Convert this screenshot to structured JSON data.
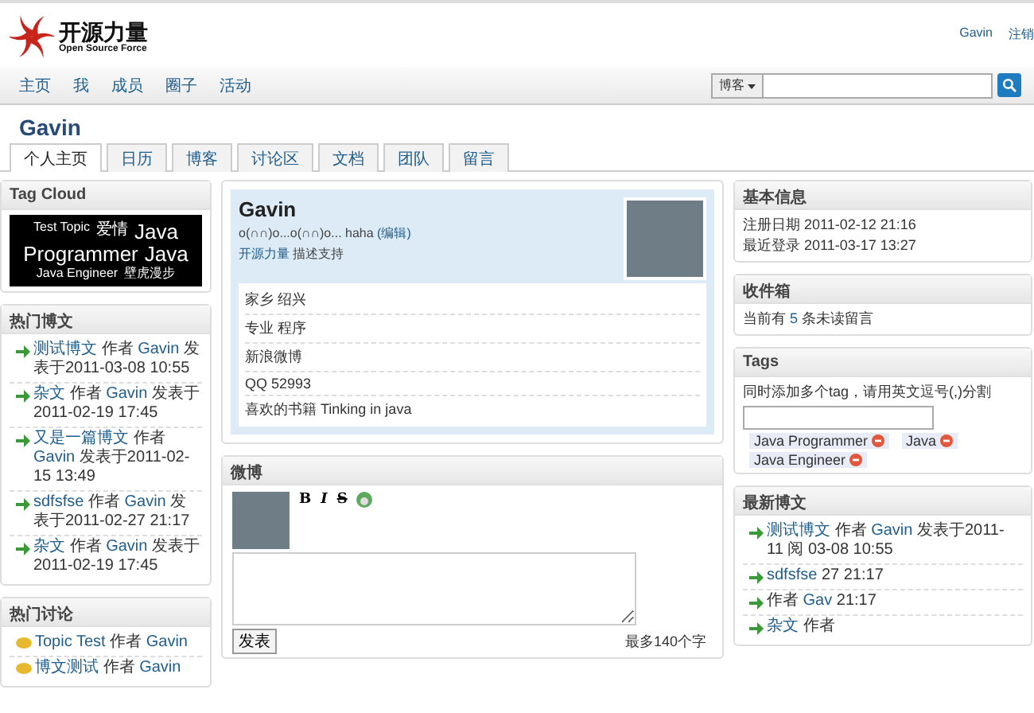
{
  "header": {
    "logo_title": "开源力量",
    "logo_subtitle": "Open Source Force",
    "user_links": [
      "Gavin",
      "注销"
    ]
  },
  "nav": {
    "items": [
      "主页",
      "我",
      "成员",
      "圈子",
      "活动"
    ],
    "search": {
      "scope": "博客"
    }
  },
  "profile_title": "Gavin",
  "tabs": [
    {
      "label": "个人主页",
      "selected": true
    },
    {
      "label": "日历",
      "selected": false
    },
    {
      "label": "博客",
      "selected": false
    },
    {
      "label": "讨论区",
      "selected": false
    },
    {
      "label": "文档",
      "selected": false
    },
    {
      "label": "团队",
      "selected": false
    },
    {
      "label": "留言",
      "selected": false
    }
  ],
  "tag_cloud": {
    "title": "Tag Cloud",
    "tags": [
      {
        "text": "Test Topic",
        "kind": "small"
      },
      {
        "text": "爱情",
        "kind": "medium"
      },
      {
        "text": "Java",
        "kind": "large"
      },
      {
        "text": "Programmer",
        "kind": "large"
      },
      {
        "text": "Java",
        "kind": "large"
      },
      {
        "text": "Java Engineer",
        "kind": "small"
      },
      {
        "text": "壁虎漫步",
        "kind": "small"
      }
    ]
  },
  "hot_posts": {
    "title": "热门博文",
    "items": [
      {
        "title": "测试博文",
        "by": "作者",
        "author": "Gavin",
        "posted": "发表于2011-03-08 10:55"
      },
      {
        "title": "杂文",
        "by": "作者",
        "author": "Gavin",
        "posted": "发表于2011-02-19 17:45"
      },
      {
        "title": "又是一篇博文",
        "by": "作者",
        "author": "Gavin",
        "posted": "发表于2011-02-15 13:49"
      },
      {
        "title": "sdfsfse",
        "by": "作者",
        "author": "Gavin",
        "posted": "发表于2011-02-27 21:17"
      },
      {
        "title": "杂文",
        "by": "作者",
        "author": "Gavin",
        "posted": "发表于2011-02-19 17:45"
      }
    ]
  },
  "hot_discussions": {
    "title": "热门讨论",
    "items": [
      {
        "title": "Topic Test",
        "by": "作者",
        "author": "Gavin"
      },
      {
        "title": "博文测试",
        "by": "作者",
        "author": "Gavin"
      }
    ]
  },
  "profile": {
    "name": "Gavin",
    "motto": "o(∩∩)o...o(∩∩)o... haha",
    "edit_link": "(编辑)",
    "site_link": "开源力量",
    "description": "描述支持",
    "fields": [
      {
        "label": "家乡",
        "value": "绍兴"
      },
      {
        "label": "专业",
        "value": "程序"
      },
      {
        "label": "新浪微博"
      },
      {
        "label": "QQ",
        "value": "52993"
      },
      {
        "label": "喜欢的书籍",
        "value": "Tinking in java"
      }
    ]
  },
  "microblog": {
    "title": "微博",
    "tools": [
      "B",
      "I",
      "S"
    ],
    "submit": "发表",
    "limit": "最多140个字"
  },
  "basic_info": {
    "title": "基本信息",
    "rows": [
      {
        "label": "注册日期",
        "value": "2011-02-12 21:16"
      },
      {
        "label": "最近登录",
        "value": "2011-03-17 13:27"
      }
    ]
  },
  "inbox": {
    "title": "收件箱",
    "before": "当前有",
    "count": "5",
    "after": "条未读留言"
  },
  "tags": {
    "title": "Tags",
    "hint": "同时添加多个tag，请用英文逗号(,)分割",
    "items": [
      "Java Programmer",
      "Java",
      "Java Engineer"
    ]
  },
  "latest_posts": {
    "title": "最新博文",
    "items": [
      {
        "title": "测试博文",
        "by": "作者",
        "author": "Gavin",
        "posted": "发表于2011- 11 阅 03-08 10:55"
      },
      {
        "title": "sdfsfse",
        "posted": "27 21:17"
      },
      {
        "by": "作者",
        "author": "Gav",
        "posted": "21:17"
      },
      {
        "title": "杂文",
        "by": "作者"
      }
    ]
  }
}
